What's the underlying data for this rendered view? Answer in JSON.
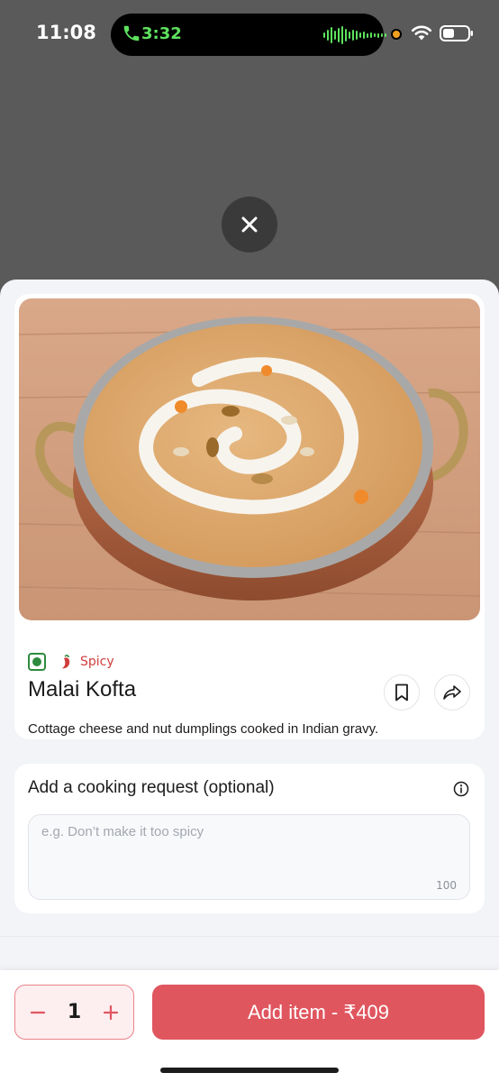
{
  "status_bar": {
    "time": "11:08",
    "call_time": "3:32"
  },
  "sheet": {
    "item": {
      "diet_tag": "veg",
      "spice_label": "Spicy",
      "name": "Malai Kofta",
      "description": "Cottage cheese and nut dumplings cooked in Indian gravy."
    },
    "cooking_request": {
      "title": "Add a cooking request (optional)",
      "placeholder": "e.g. Don’t make it too spicy",
      "char_limit": "100"
    }
  },
  "bottom_bar": {
    "quantity": "1",
    "add_button_label": "Add item - ₹409"
  },
  "colors": {
    "accent": "#e0565f",
    "veg_green": "#2e8b3d",
    "spicy_red": "#d13c3c",
    "call_green": "#5ee35e"
  },
  "icons": [
    "phone-icon",
    "waveform-icon",
    "wifi-icon",
    "battery-icon",
    "close-icon",
    "veg-icon",
    "chili-icon",
    "bookmark-icon",
    "share-icon",
    "info-icon",
    "minus-icon",
    "plus-icon"
  ]
}
